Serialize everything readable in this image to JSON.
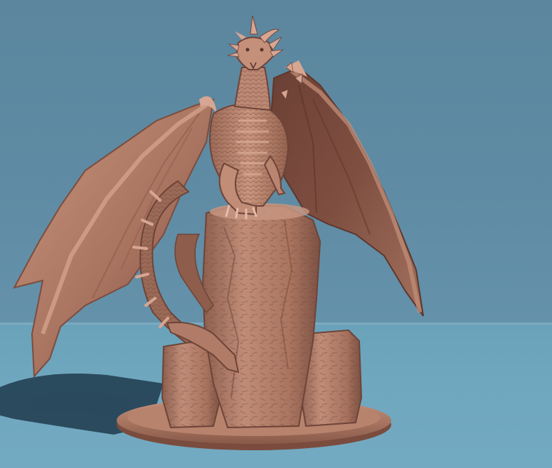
{
  "scene": {
    "subject": "dragon-miniature",
    "colors": {
      "wall": "#5f8aa3",
      "floor": "#6fa7bf",
      "model": "#b7826f",
      "model_dark": "#6e4438",
      "model_light": "#d6a692",
      "shadow": "#1f3a4c"
    }
  }
}
